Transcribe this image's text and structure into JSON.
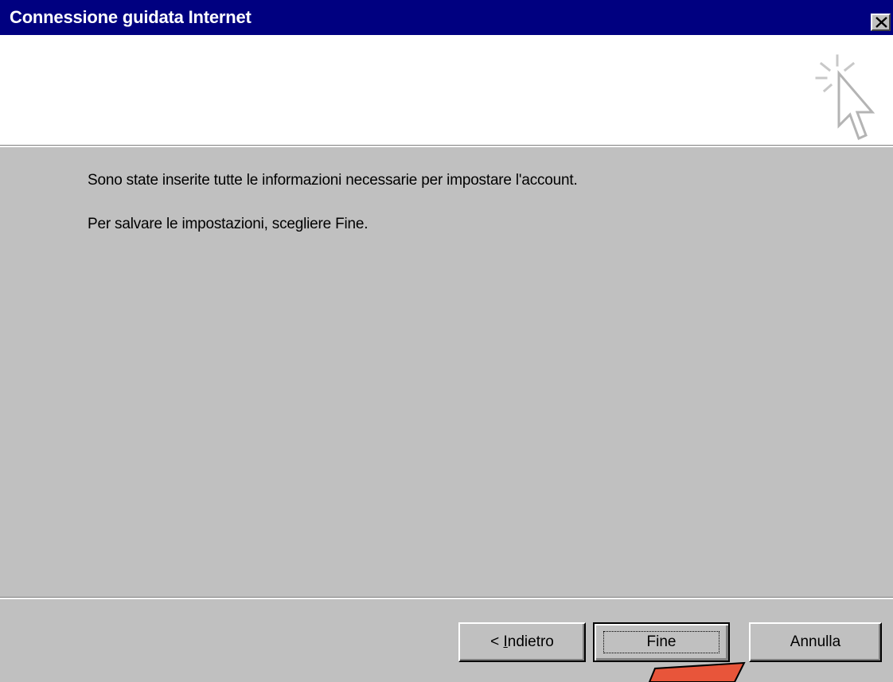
{
  "window": {
    "title": "Connessione guidata Internet"
  },
  "content": {
    "message_1": "Sono state inserite tutte le informazioni necessarie per impostare l'account.",
    "message_2": "Per salvare le impostazioni, scegliere Fine."
  },
  "buttons": {
    "back_prefix": "< ",
    "back_mnemonic": "I",
    "back_rest": "ndietro",
    "finish_label": "Fine",
    "cancel_label": "Annulla"
  },
  "icons": {
    "close": "close-icon",
    "wizard": "wizard-cursor-icon",
    "annotation": "red-arrow-annotation"
  },
  "colors": {
    "titlebar": "#000080",
    "dialog_face": "#c0c0c0",
    "header_bg": "#ffffff",
    "annotation": "#e8553a"
  }
}
